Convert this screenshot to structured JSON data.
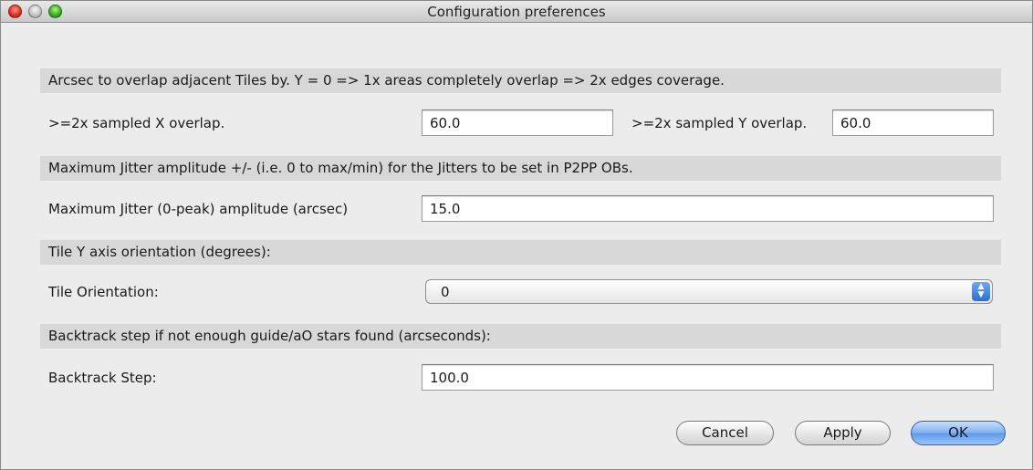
{
  "window": {
    "title": "Configuration preferences"
  },
  "overlap": {
    "header": "Arcsec to overlap adjacent Tiles by. Y = 0 => 1x areas completely overlap => 2x edges coverage.",
    "x_label": ">=2x sampled X overlap.",
    "x_value": "60.0",
    "y_label": ">=2x sampled Y overlap.",
    "y_value": "60.0"
  },
  "jitter": {
    "header": "Maximum Jitter amplitude +/- (i.e. 0 to max/min) for the Jitters to be set in P2PP OBs.",
    "label": "Maximum Jitter (0-peak) amplitude (arcsec)",
    "value": "15.0"
  },
  "orientation": {
    "header": "Tile Y axis orientation (degrees):",
    "label": "Tile Orientation:",
    "selected": "0",
    "arrow_icon": "updown-arrows-icon"
  },
  "backtrack": {
    "header": "Backtrack step if not enough guide/aO stars found (arcseconds):",
    "label": "Backtrack Step:",
    "value": "100.0"
  },
  "buttons": {
    "cancel": "Cancel",
    "apply": "Apply",
    "ok": "OK"
  },
  "colors": {
    "close_light": "#e0321f",
    "minimize_light": "#c6c6c6",
    "zoom_light": "#3fb027",
    "default_button": "#5d98ea"
  }
}
